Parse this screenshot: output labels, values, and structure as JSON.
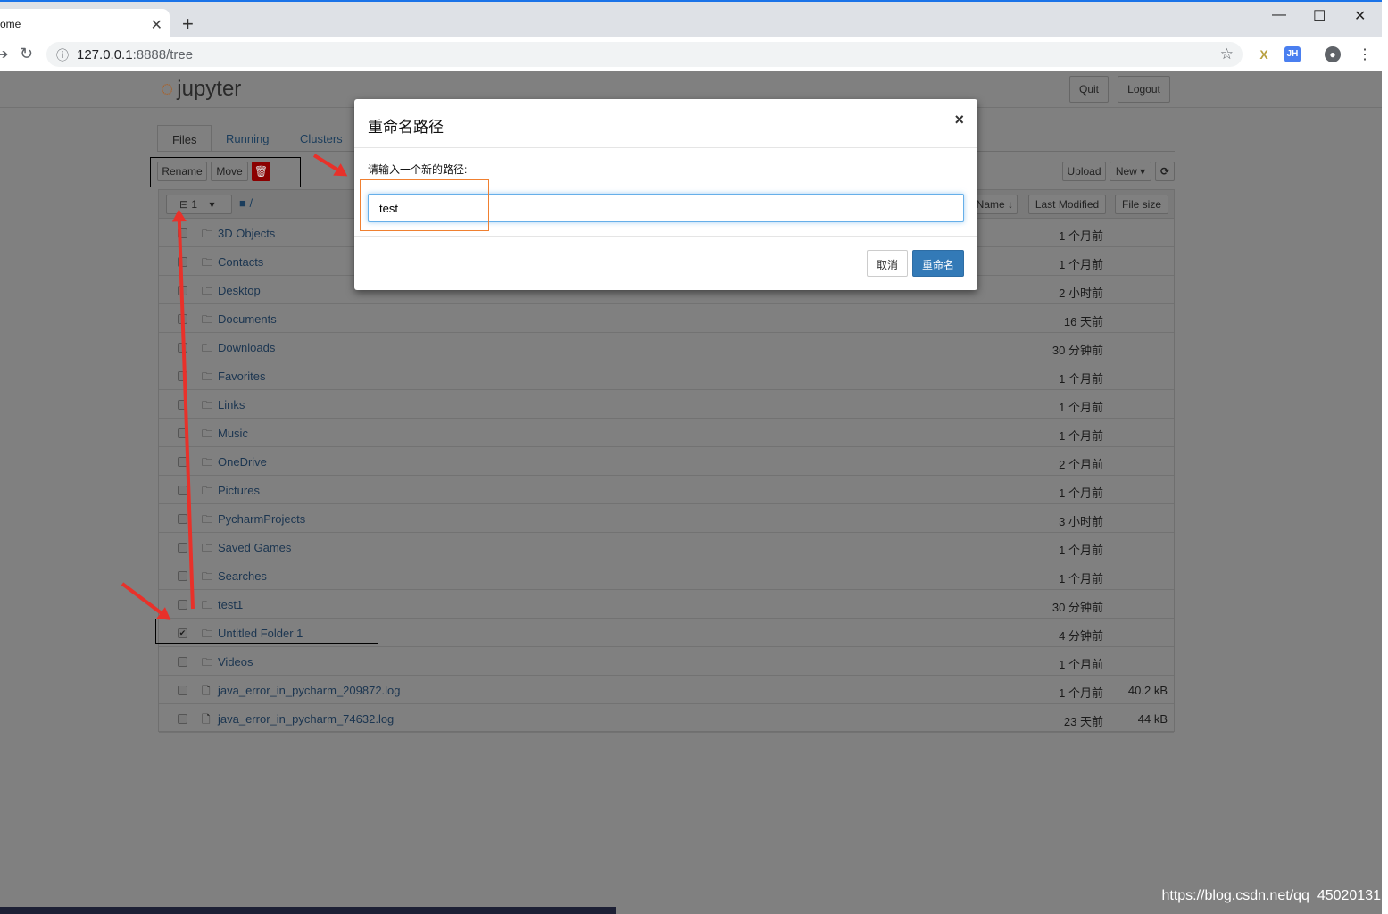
{
  "browser": {
    "tab_title": "ome",
    "url_host": "127.0.0.1",
    "url_path": ":8888/tree",
    "ext_jh": "JH",
    "ext_x": "X"
  },
  "header": {
    "logo": "jupyter",
    "quit": "Quit",
    "logout": "Logout"
  },
  "tabs": [
    {
      "label": "Files"
    },
    {
      "label": "Running"
    },
    {
      "label": "Clusters"
    }
  ],
  "actions": {
    "rename": "Rename",
    "move": "Move",
    "upload": "Upload",
    "new": "New ▾",
    "refresh": "⟳"
  },
  "list_header": {
    "selected_count": "1",
    "path": "/",
    "name_sort": "Name ↓",
    "last_modified": "Last Modified",
    "file_size": "File size"
  },
  "rows": [
    {
      "name": "3D Objects",
      "type": "folder",
      "modified": "1 个月前",
      "size": "",
      "checked": false
    },
    {
      "name": "Contacts",
      "type": "folder",
      "modified": "1 个月前",
      "size": "",
      "checked": false
    },
    {
      "name": "Desktop",
      "type": "folder",
      "modified": "2 小时前",
      "size": "",
      "checked": false
    },
    {
      "name": "Documents",
      "type": "folder",
      "modified": "16 天前",
      "size": "",
      "checked": false
    },
    {
      "name": "Downloads",
      "type": "folder",
      "modified": "30 分钟前",
      "size": "",
      "checked": false
    },
    {
      "name": "Favorites",
      "type": "folder",
      "modified": "1 个月前",
      "size": "",
      "checked": false
    },
    {
      "name": "Links",
      "type": "folder",
      "modified": "1 个月前",
      "size": "",
      "checked": false
    },
    {
      "name": "Music",
      "type": "folder",
      "modified": "1 个月前",
      "size": "",
      "checked": false
    },
    {
      "name": "OneDrive",
      "type": "folder",
      "modified": "2 个月前",
      "size": "",
      "checked": false
    },
    {
      "name": "Pictures",
      "type": "folder",
      "modified": "1 个月前",
      "size": "",
      "checked": false
    },
    {
      "name": "PycharmProjects",
      "type": "folder",
      "modified": "3 小时前",
      "size": "",
      "checked": false
    },
    {
      "name": "Saved Games",
      "type": "folder",
      "modified": "1 个月前",
      "size": "",
      "checked": false
    },
    {
      "name": "Searches",
      "type": "folder",
      "modified": "1 个月前",
      "size": "",
      "checked": false
    },
    {
      "name": "test1",
      "type": "folder",
      "modified": "30 分钟前",
      "size": "",
      "checked": false
    },
    {
      "name": "Untitled Folder 1",
      "type": "folder",
      "modified": "4 分钟前",
      "size": "",
      "checked": true
    },
    {
      "name": "Videos",
      "type": "folder",
      "modified": "1 个月前",
      "size": "",
      "checked": false
    },
    {
      "name": "java_error_in_pycharm_209872.log",
      "type": "file",
      "modified": "1 个月前",
      "size": "40.2 kB",
      "checked": false
    },
    {
      "name": "java_error_in_pycharm_74632.log",
      "type": "file",
      "modified": "23 天前",
      "size": "44 kB",
      "checked": false
    }
  ],
  "modal": {
    "title": "重命名路径",
    "label": "请输入一个新的路径:",
    "value": "test",
    "cancel": "取消",
    "confirm": "重命名",
    "close": "×"
  },
  "colors": {
    "primary": "#337ab7",
    "delete": "#c9302c",
    "annotation": "#e8312a"
  },
  "watermark": "https://blog.csdn.net/qq_45020131"
}
